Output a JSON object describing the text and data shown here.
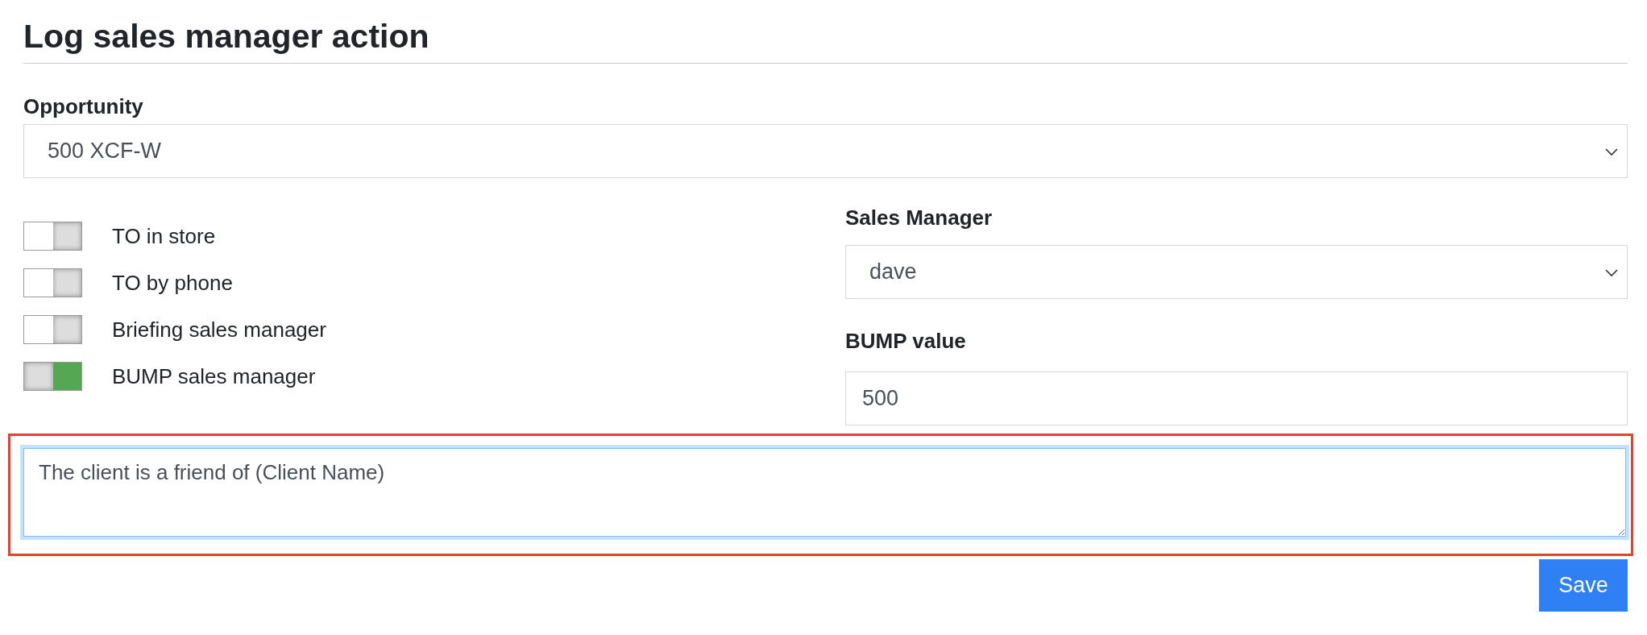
{
  "title": "Log sales manager action",
  "opportunity": {
    "label": "Opportunity",
    "value": "500 XCF-W"
  },
  "toggles": [
    {
      "label": "TO in store",
      "on": false
    },
    {
      "label": "TO by phone",
      "on": false
    },
    {
      "label": "Briefing sales manager",
      "on": false
    },
    {
      "label": "BUMP sales manager",
      "on": true
    }
  ],
  "sales_manager": {
    "label": "Sales Manager",
    "value": "dave"
  },
  "bump_value": {
    "label": "BUMP value",
    "value": "500"
  },
  "notes": {
    "value": "The client is a friend of (Client Name)",
    "highlighted": true
  },
  "save_button": "Save"
}
